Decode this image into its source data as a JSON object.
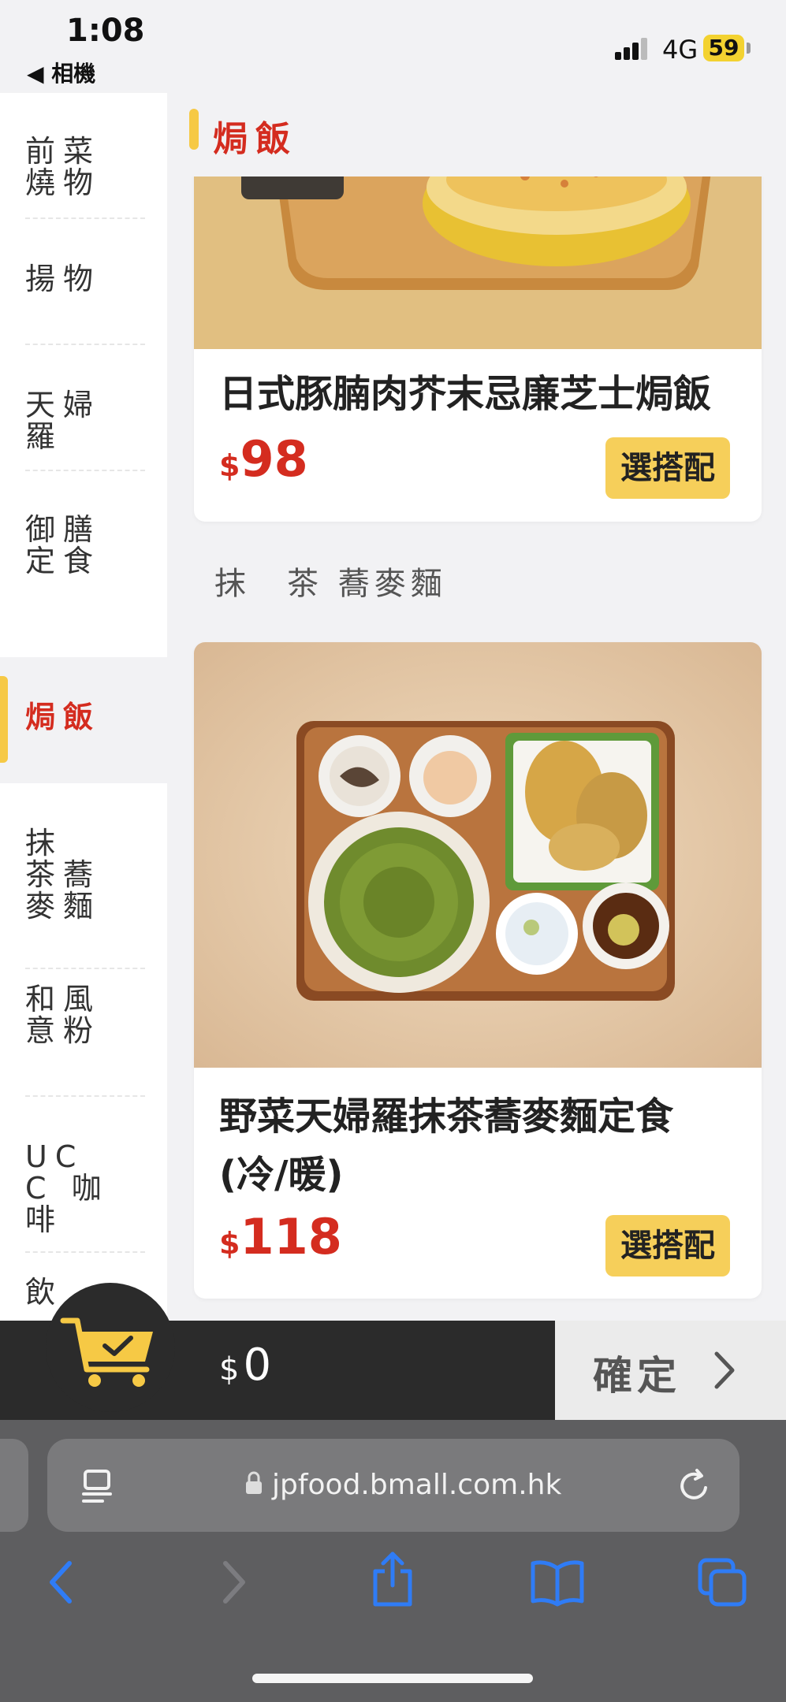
{
  "status_bar": {
    "time": "1:08",
    "back_app": "◀ 相機",
    "network": "4G",
    "battery": "59"
  },
  "sidebar": {
    "items": [
      {
        "label": "前菜燒物",
        "active": false
      },
      {
        "label": "揚物",
        "active": false
      },
      {
        "label": "天婦羅",
        "active": false
      },
      {
        "label": "御膳定食",
        "active": false
      },
      {
        "label": "焗飯",
        "active": true
      },
      {
        "label": "抹 茶蕎麥麵",
        "active": false
      },
      {
        "label": "和風意粉",
        "active": false
      },
      {
        "label": "UCC 咖啡",
        "active": false
      },
      {
        "label": "飲",
        "active": false
      }
    ]
  },
  "main": {
    "section_title": "焗飯",
    "subsection_title": "抹　茶 蕎麥麵",
    "items": [
      {
        "name": "日式豚腩肉芥末忌廉芝士焗飯",
        "currency": "$",
        "price": "98",
        "button": "選搭配"
      },
      {
        "name": "野菜天婦羅抹茶蕎麥麵定食(冷/暖)",
        "currency": "$",
        "price": "118",
        "button": "選搭配"
      }
    ]
  },
  "cart": {
    "currency": "$",
    "total": "0",
    "confirm_label": "確定"
  },
  "browser": {
    "url": "jpfood.bmall.com.hk"
  },
  "colors": {
    "accent_red": "#d42c1f",
    "accent_yellow": "#f6c945",
    "button_yellow": "#f6cf5a",
    "ios_blue": "#2f7cf6"
  }
}
